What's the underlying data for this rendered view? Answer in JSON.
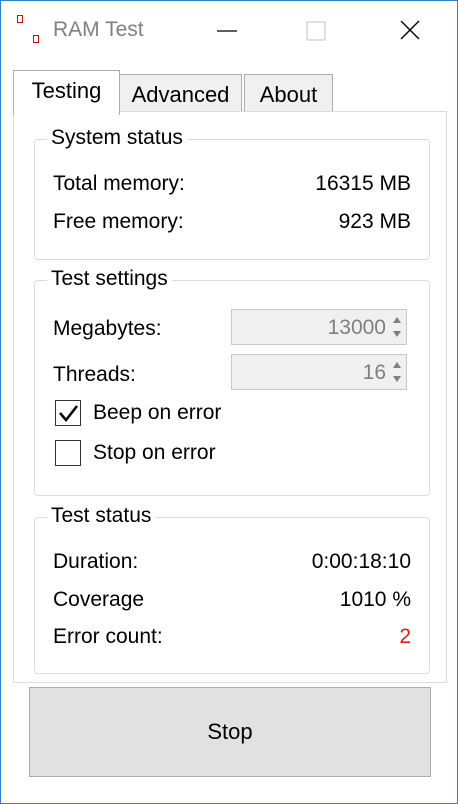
{
  "window": {
    "title": "RAM Test"
  },
  "tabs": [
    {
      "label": "Testing"
    },
    {
      "label": "Advanced"
    },
    {
      "label": "About"
    }
  ],
  "system_status": {
    "title": "System status",
    "total_label": "Total memory:",
    "total_value": "16315 MB",
    "free_label": "Free memory:",
    "free_value": "923 MB"
  },
  "test_settings": {
    "title": "Test settings",
    "megabytes_label": "Megabytes:",
    "megabytes_value": "13000",
    "threads_label": "Threads:",
    "threads_value": "16",
    "beep_label": "Beep on error",
    "beep_checked": true,
    "stop_label": "Stop on error",
    "stop_checked": false
  },
  "test_status": {
    "title": "Test status",
    "duration_label": "Duration:",
    "duration_value": "0:00:18:10",
    "coverage_label": "Coverage",
    "coverage_value": "1010 %",
    "errors_label": "Error count:",
    "errors_value": "2"
  },
  "stop_button": {
    "label": "Stop"
  },
  "colors": {
    "error": "#e51a1a",
    "icon_red": "#c81010",
    "border": "#2b7fd8"
  }
}
